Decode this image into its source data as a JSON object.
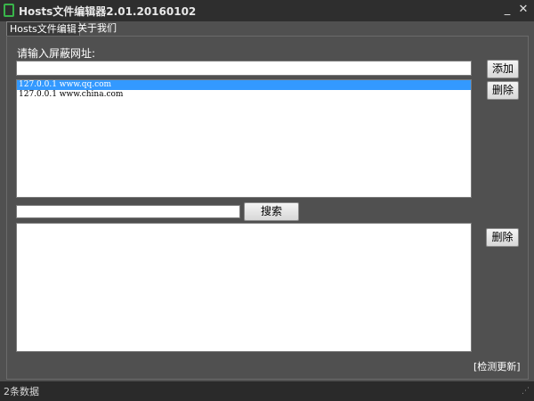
{
  "window": {
    "title": "Hosts文件编辑器2.01.20160102",
    "minimize_label": "_",
    "close_label": "✕"
  },
  "tabs": [
    {
      "label": "Hosts文件编辑",
      "active": true
    },
    {
      "label": "关于我们",
      "active": false
    }
  ],
  "block_section": {
    "label": "请输入屏蔽网址:",
    "input_value": "",
    "add_button": "添加",
    "delete_button": "删除",
    "entries": [
      {
        "text": "127.0.0.1 www.qq.com",
        "selected": true
      },
      {
        "text": "127.0.0.1 www.china.com",
        "selected": false
      }
    ]
  },
  "search_section": {
    "input_value": "",
    "search_button": "搜索",
    "delete_button": "删除",
    "results": []
  },
  "check_update_link": "[检测更新]",
  "statusbar": {
    "text": "2条数据"
  }
}
